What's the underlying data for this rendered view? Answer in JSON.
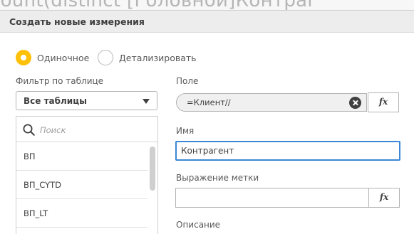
{
  "background": {
    "partial_expression": "count(distinct [Головной]Контраг"
  },
  "dialog": {
    "title": "Создать новые измерения"
  },
  "type_options": [
    {
      "label": "Одиночное",
      "selected": true
    },
    {
      "label": "Детализировать",
      "selected": false
    }
  ],
  "table_filter": {
    "label": "Фильтр по таблице",
    "selected": "Все таблицы"
  },
  "field_list": {
    "search_placeholder": "Поиск",
    "items": [
      "ВП",
      "ВП_CYTD",
      "ВП_LT"
    ]
  },
  "field": {
    "label": "Поле",
    "value": "=Клиент//",
    "fx_label": "fx"
  },
  "name": {
    "label": "Имя",
    "value": "Контрагент"
  },
  "label_expression": {
    "label": "Выражение метки",
    "value": "",
    "fx_label": "fx"
  },
  "description": {
    "label": "Описание"
  },
  "colors": {
    "accent": "#ffc107",
    "focus": "#3b88d6"
  },
  "icons": {
    "search": "search-icon",
    "clear": "clear-icon",
    "dropdown": "caret-down-icon"
  }
}
